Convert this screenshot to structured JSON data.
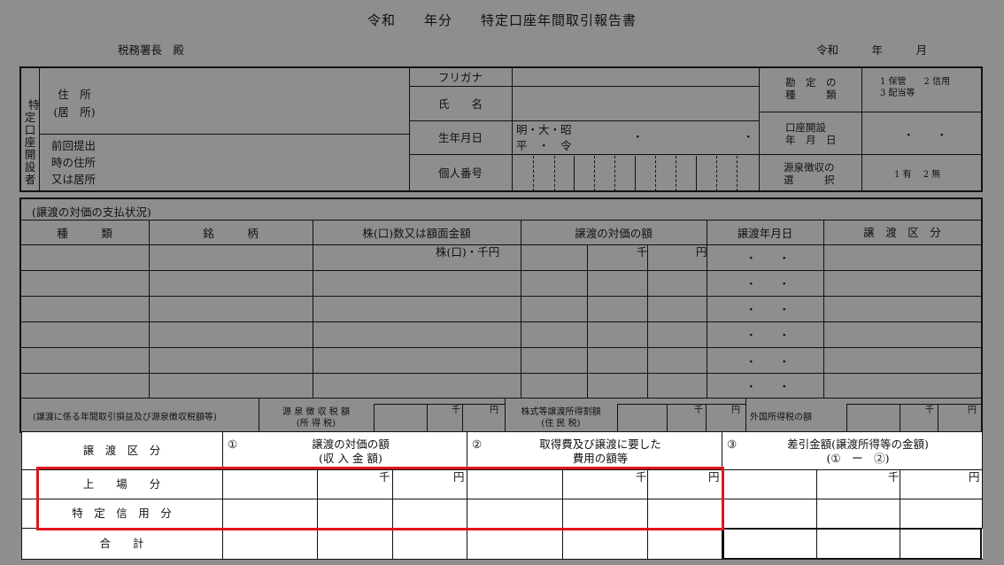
{
  "header": {
    "title": "令和　　年分　　特定口座年間取引報告書",
    "addressee": "税務署長　殿",
    "date": "令和　　　年　　　月"
  },
  "account_holder": {
    "side_label": [
      "特",
      "定",
      "口",
      "座",
      "開",
      "設",
      "者"
    ],
    "address": "住　所\n(居　所)",
    "prev_address": "前回提出\n時の住所\n又は居所",
    "furigana": "フリガナ",
    "name": "氏　　名",
    "birthdate": "生年月日",
    "era_line1": "明・大・昭",
    "era_line2": "平　・　令",
    "birth_dots": "・　　　　　　　　　・",
    "individual_number": "個人番号",
    "account_type": "勘　定　の\n種　　　類",
    "account_type_options": "1 保管　　2 信用\n3 配当等",
    "opening_date": "口座開設\n年　月　日",
    "opening_dots": "・　　・",
    "withholding": "源泉徴収の\n選　　　択",
    "withholding_options": "1 有　 2 無"
  },
  "payments": {
    "section_title": "(譲渡の対価の支払状況)",
    "columns": [
      "種　　　類",
      "銘　　　柄",
      "株(口)数又は額面金額",
      "譲渡の対価の額",
      "譲渡年月日",
      "譲　渡　区　分"
    ],
    "unit_shares": "株(口)・千円",
    "unit_thousand": "千",
    "unit_yen": "円",
    "date_dots": "・　　・"
  },
  "tax_row": {
    "label": "(譲渡に係る年間取引損益及び源泉徴収税額等)",
    "withholding_tax": "源 泉 徴 収 税 額\n(所 得 税)",
    "local_tax": "株式等譲渡所得割額\n(住 民 税)",
    "foreign_tax": "外国所得税の額",
    "thousand": "千",
    "yen": "円"
  },
  "summary": {
    "col_category": "譲　渡　区　分",
    "col1_num": "①",
    "col1": "譲渡の対価の額\n(収 入 金 額)",
    "col2_num": "②",
    "col2": "取得費及び譲渡に要した\n費用の額等",
    "col3_num": "③",
    "col3": "差引金額(譲渡所得等の金額)\n(①　ー　②)",
    "row_listed": "上　　場　　分",
    "row_margin": "特　定　信　用　分",
    "row_total": "合　　計",
    "thousand": "千",
    "yen": "円"
  },
  "colors": {
    "background": "#8e8e8e",
    "highlight": "#e0141b",
    "line": "#111111"
  }
}
